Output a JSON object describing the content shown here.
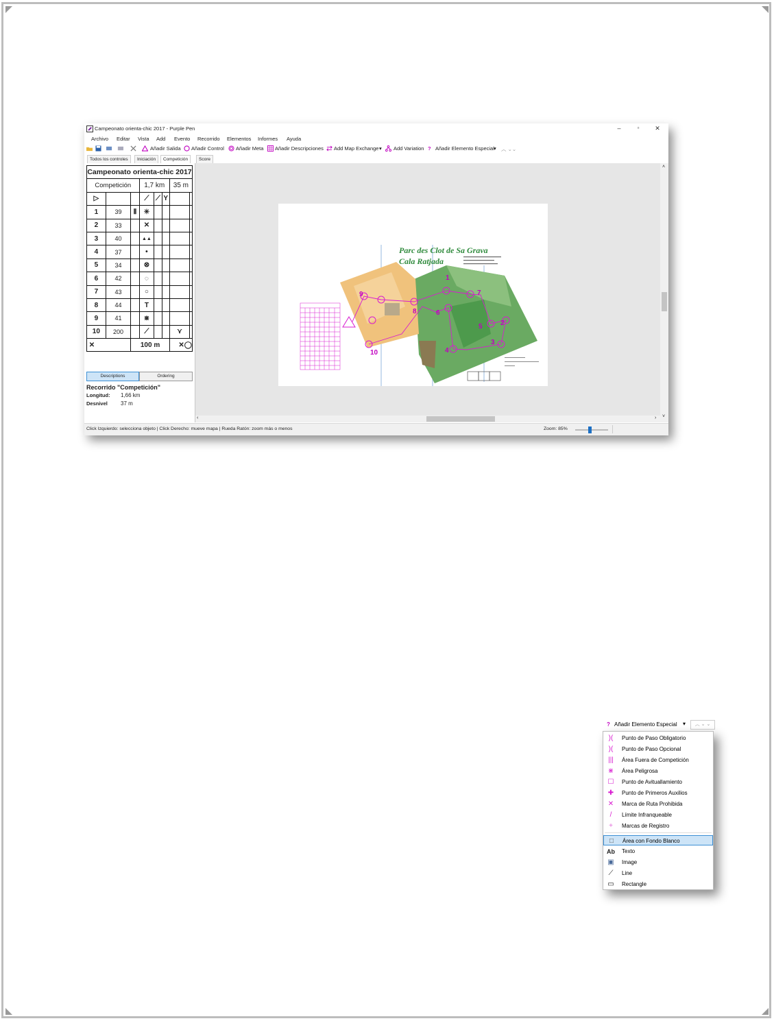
{
  "window": {
    "title": "Campeonato orienta-chic 2017 - Purple Pen",
    "controls": {
      "minimize": "–",
      "maximize": "▫",
      "close": "✕"
    }
  },
  "menu": [
    "Archivo",
    "Editar",
    "Vista",
    "Add",
    "Evento",
    "Recorrido",
    "Elementos",
    "Informes",
    "Ayuda"
  ],
  "toolbar": {
    "add_start": "Añadir Salida",
    "add_control": "Añadir Control",
    "add_finish": "Añadir Meta",
    "add_descriptions": "Añadir Descripciones",
    "add_map_exchange": "Add Map Exchange",
    "add_variation": "Add Variation",
    "add_special": "Añadir Elemento Especial"
  },
  "tabs": [
    "Todos los controles",
    "Iniciación",
    "Competición",
    "Score"
  ],
  "description_sheet": {
    "title": "Campeonato orienta-chic 2017",
    "course": "Competición",
    "length": "1,7 km",
    "climb": "35 m",
    "rows": [
      {
        "num": "1",
        "code": "39",
        "feature": "✳"
      },
      {
        "num": "2",
        "code": "33",
        "feature": "✕"
      },
      {
        "num": "3",
        "code": "40",
        "feature": "▲▲"
      },
      {
        "num": "4",
        "code": "37",
        "feature": "•"
      },
      {
        "num": "5",
        "code": "34",
        "feature": "⊗"
      },
      {
        "num": "6",
        "code": "42",
        "feature": "◌"
      },
      {
        "num": "7",
        "code": "43",
        "feature": "○"
      },
      {
        "num": "8",
        "code": "44",
        "feature": "T"
      },
      {
        "num": "9",
        "code": "41",
        "feature": "⋇"
      },
      {
        "num": "10",
        "code": "200",
        "feature": "⟋"
      }
    ],
    "finish_distance": "100 m"
  },
  "panel_buttons": {
    "descriptions": "Descriptions",
    "ordering": "Ordering"
  },
  "course_info": {
    "heading": "Recorrido \"Competición\"",
    "length_label": "Longitud:",
    "length_value": "1,66 km",
    "climb_label": "Desnivel",
    "climb_value": "37 m"
  },
  "map": {
    "title_line1": "Parc des Clot de Sa Grava",
    "title_line2": "Cala Ratjada",
    "control_numbers": [
      "1",
      "2",
      "3",
      "4",
      "5",
      "6",
      "7",
      "8",
      "9",
      "10"
    ]
  },
  "status": {
    "hint": "Click Izquierdo: selecciona objeto | Click Derecho: mueve mapa | Rueda Ratón: zoom más o menos",
    "zoom_label": "Zoom: 85%",
    "zoom_value": 0.45
  },
  "special_menu": {
    "header": "Añadir Elemento Especial",
    "items": [
      {
        "label": "Punto de Paso Obligatorio",
        "icon": ")(",
        "color": "#d81bd0"
      },
      {
        "label": "Punto de Paso Opcional",
        "icon": ")(",
        "color": "#d81bd0"
      },
      {
        "label": "Área Fuera de Competición",
        "icon": "|||",
        "color": "#d81bd0"
      },
      {
        "label": "Área Peligrosa",
        "icon": "⋇",
        "color": "#d81bd0"
      },
      {
        "label": "Punto de Avituallamiento",
        "icon": "☐",
        "color": "#d81bd0"
      },
      {
        "label": "Punto de Primeros Auxilios",
        "icon": "✚",
        "color": "#d81bd0"
      },
      {
        "label": "Marca de Ruta Prohibida",
        "icon": "✕",
        "color": "#d81bd0"
      },
      {
        "label": "Límite Infranqueable",
        "icon": "/",
        "color": "#d81bd0"
      },
      {
        "label": "Marcas de Registro",
        "icon": "+",
        "color": "#e26ad9"
      },
      {
        "label": "Área con Fondo Blanco",
        "icon": "□",
        "color": "#555555"
      },
      {
        "label": "Texto",
        "icon": "Ab",
        "color": "#222222"
      },
      {
        "label": "Image",
        "icon": "▣",
        "color": "#4a6a9a"
      },
      {
        "label": "Line",
        "icon": "⟋",
        "color": "#111111"
      },
      {
        "label": "Rectangle",
        "icon": "▭",
        "color": "#111111"
      }
    ],
    "selected_index": 9
  }
}
